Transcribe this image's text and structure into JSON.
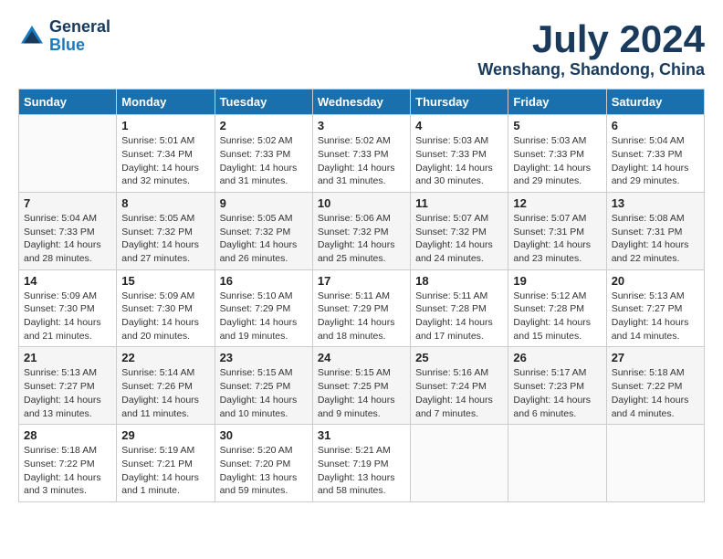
{
  "logo": {
    "line1": "General",
    "line2": "Blue"
  },
  "title": "July 2024",
  "subtitle": "Wenshang, Shandong, China",
  "days_of_week": [
    "Sunday",
    "Monday",
    "Tuesday",
    "Wednesday",
    "Thursday",
    "Friday",
    "Saturday"
  ],
  "weeks": [
    [
      {
        "day": "",
        "info": ""
      },
      {
        "day": "1",
        "info": "Sunrise: 5:01 AM\nSunset: 7:34 PM\nDaylight: 14 hours\nand 32 minutes."
      },
      {
        "day": "2",
        "info": "Sunrise: 5:02 AM\nSunset: 7:33 PM\nDaylight: 14 hours\nand 31 minutes."
      },
      {
        "day": "3",
        "info": "Sunrise: 5:02 AM\nSunset: 7:33 PM\nDaylight: 14 hours\nand 31 minutes."
      },
      {
        "day": "4",
        "info": "Sunrise: 5:03 AM\nSunset: 7:33 PM\nDaylight: 14 hours\nand 30 minutes."
      },
      {
        "day": "5",
        "info": "Sunrise: 5:03 AM\nSunset: 7:33 PM\nDaylight: 14 hours\nand 29 minutes."
      },
      {
        "day": "6",
        "info": "Sunrise: 5:04 AM\nSunset: 7:33 PM\nDaylight: 14 hours\nand 29 minutes."
      }
    ],
    [
      {
        "day": "7",
        "info": "Sunrise: 5:04 AM\nSunset: 7:33 PM\nDaylight: 14 hours\nand 28 minutes."
      },
      {
        "day": "8",
        "info": "Sunrise: 5:05 AM\nSunset: 7:32 PM\nDaylight: 14 hours\nand 27 minutes."
      },
      {
        "day": "9",
        "info": "Sunrise: 5:05 AM\nSunset: 7:32 PM\nDaylight: 14 hours\nand 26 minutes."
      },
      {
        "day": "10",
        "info": "Sunrise: 5:06 AM\nSunset: 7:32 PM\nDaylight: 14 hours\nand 25 minutes."
      },
      {
        "day": "11",
        "info": "Sunrise: 5:07 AM\nSunset: 7:32 PM\nDaylight: 14 hours\nand 24 minutes."
      },
      {
        "day": "12",
        "info": "Sunrise: 5:07 AM\nSunset: 7:31 PM\nDaylight: 14 hours\nand 23 minutes."
      },
      {
        "day": "13",
        "info": "Sunrise: 5:08 AM\nSunset: 7:31 PM\nDaylight: 14 hours\nand 22 minutes."
      }
    ],
    [
      {
        "day": "14",
        "info": "Sunrise: 5:09 AM\nSunset: 7:30 PM\nDaylight: 14 hours\nand 21 minutes."
      },
      {
        "day": "15",
        "info": "Sunrise: 5:09 AM\nSunset: 7:30 PM\nDaylight: 14 hours\nand 20 minutes."
      },
      {
        "day": "16",
        "info": "Sunrise: 5:10 AM\nSunset: 7:29 PM\nDaylight: 14 hours\nand 19 minutes."
      },
      {
        "day": "17",
        "info": "Sunrise: 5:11 AM\nSunset: 7:29 PM\nDaylight: 14 hours\nand 18 minutes."
      },
      {
        "day": "18",
        "info": "Sunrise: 5:11 AM\nSunset: 7:28 PM\nDaylight: 14 hours\nand 17 minutes."
      },
      {
        "day": "19",
        "info": "Sunrise: 5:12 AM\nSunset: 7:28 PM\nDaylight: 14 hours\nand 15 minutes."
      },
      {
        "day": "20",
        "info": "Sunrise: 5:13 AM\nSunset: 7:27 PM\nDaylight: 14 hours\nand 14 minutes."
      }
    ],
    [
      {
        "day": "21",
        "info": "Sunrise: 5:13 AM\nSunset: 7:27 PM\nDaylight: 14 hours\nand 13 minutes."
      },
      {
        "day": "22",
        "info": "Sunrise: 5:14 AM\nSunset: 7:26 PM\nDaylight: 14 hours\nand 11 minutes."
      },
      {
        "day": "23",
        "info": "Sunrise: 5:15 AM\nSunset: 7:25 PM\nDaylight: 14 hours\nand 10 minutes."
      },
      {
        "day": "24",
        "info": "Sunrise: 5:15 AM\nSunset: 7:25 PM\nDaylight: 14 hours\nand 9 minutes."
      },
      {
        "day": "25",
        "info": "Sunrise: 5:16 AM\nSunset: 7:24 PM\nDaylight: 14 hours\nand 7 minutes."
      },
      {
        "day": "26",
        "info": "Sunrise: 5:17 AM\nSunset: 7:23 PM\nDaylight: 14 hours\nand 6 minutes."
      },
      {
        "day": "27",
        "info": "Sunrise: 5:18 AM\nSunset: 7:22 PM\nDaylight: 14 hours\nand 4 minutes."
      }
    ],
    [
      {
        "day": "28",
        "info": "Sunrise: 5:18 AM\nSunset: 7:22 PM\nDaylight: 14 hours\nand 3 minutes."
      },
      {
        "day": "29",
        "info": "Sunrise: 5:19 AM\nSunset: 7:21 PM\nDaylight: 14 hours\nand 1 minute."
      },
      {
        "day": "30",
        "info": "Sunrise: 5:20 AM\nSunset: 7:20 PM\nDaylight: 13 hours\nand 59 minutes."
      },
      {
        "day": "31",
        "info": "Sunrise: 5:21 AM\nSunset: 7:19 PM\nDaylight: 13 hours\nand 58 minutes."
      },
      {
        "day": "",
        "info": ""
      },
      {
        "day": "",
        "info": ""
      },
      {
        "day": "",
        "info": ""
      }
    ]
  ]
}
